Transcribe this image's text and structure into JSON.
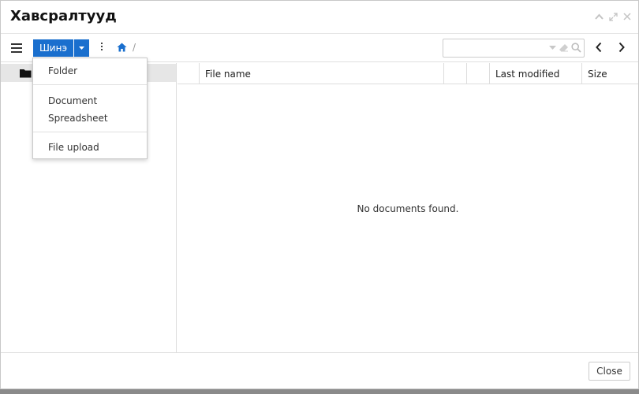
{
  "dialog": {
    "title": "Хавсралтууд",
    "icons": [
      "chevron-up-icon",
      "maximize-icon",
      "close-icon"
    ]
  },
  "toolbar": {
    "new_label": "Шинэ",
    "breadcrumb_separator": "/",
    "accent_color": "#1a6fce"
  },
  "menu": {
    "items": [
      {
        "label": "Folder"
      },
      {
        "label": "Document"
      },
      {
        "label": "Spreadsheet"
      },
      {
        "label": "File upload"
      }
    ]
  },
  "grid": {
    "columns": [
      "File name",
      "Last modified",
      "Size"
    ],
    "empty_text": "No documents found."
  },
  "footer": {
    "close_label": "Close"
  }
}
